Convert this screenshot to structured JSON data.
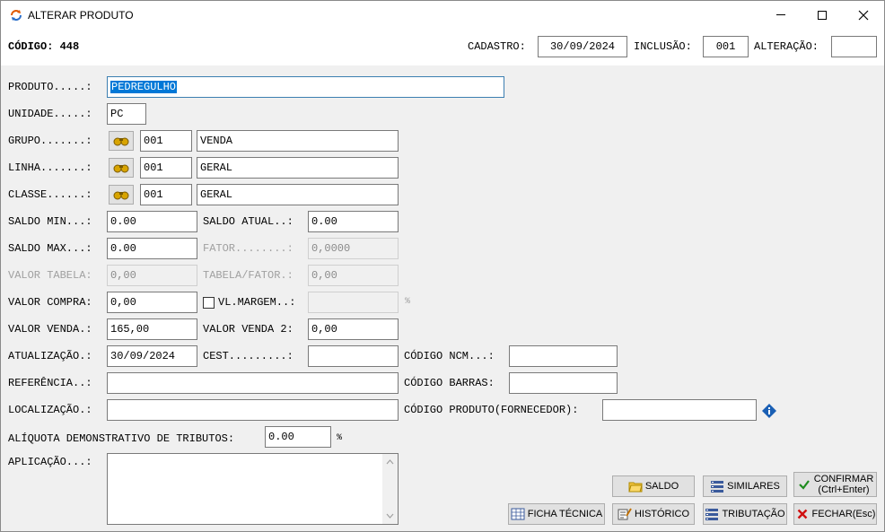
{
  "window": {
    "title": "ALTERAR PRODUTO"
  },
  "header": {
    "codigo": "CÓDIGO: 448",
    "cadastro_label": "CADASTRO:",
    "cadastro_value": "30/09/2024",
    "inclusao_label": "INCLUSÃO:",
    "inclusao_value": "001",
    "alteracao_label": "ALTERAÇÃO:",
    "alteracao_value": ""
  },
  "form": {
    "produto_label": "PRODUTO.....:",
    "produto_value": "PEDREGULHO",
    "unidade_label": "UNIDADE.....:",
    "unidade_value": "PC",
    "grupo_label": "GRUPO.......:",
    "grupo_code": "001",
    "grupo_name": "VENDA",
    "linha_label": "LINHA.......:",
    "linha_code": "001",
    "linha_name": "GERAL",
    "classe_label": "CLASSE......:",
    "classe_code": "001",
    "classe_name": "GERAL",
    "saldo_min_label": "SALDO MIN...:",
    "saldo_min_value": "0.00",
    "saldo_atual_label": "SALDO ATUAL..:",
    "saldo_atual_value": "0.00",
    "saldo_max_label": "SALDO MAX...:",
    "saldo_max_value": "0.00",
    "fator_label": "FATOR........:",
    "fator_value": "0,0000",
    "valor_tabela_label": "VALOR TABELA:",
    "valor_tabela_value": "0,00",
    "tabela_fator_label": "TABELA/FATOR.:",
    "tabela_fator_value": "0,00",
    "valor_compra_label": "VALOR COMPRA:",
    "valor_compra_value": "0,00",
    "vl_margem_label": "VL.MARGEM..:",
    "vl_margem_value": "",
    "percent": "%",
    "valor_venda_label": "VALOR VENDA.:",
    "valor_venda_value": "165,00",
    "valor_venda2_label": "VALOR VENDA 2:",
    "valor_venda2_value": "0,00",
    "atualizacao_label": "ATUALIZAÇÃO.:",
    "atualizacao_value": "30/09/2024",
    "cest_label": "CEST.........:",
    "cest_value": "",
    "ncm_label": "CÓDIGO NCM...:",
    "ncm_value": "",
    "referencia_label": "REFERÊNCIA..:",
    "referencia_value": "",
    "barras_label": "CÓDIGO BARRAS:",
    "barras_value": "",
    "localizacao_label": "LOCALIZAÇÃO.:",
    "localizacao_value": "",
    "cod_fornecedor_label": "CÓDIGO PRODUTO(FORNECEDOR):",
    "cod_fornecedor_value": "",
    "aliquota_label": "ALÍQUOTA DEMONSTRATIVO DE TRIBUTOS:",
    "aliquota_value": "0.00",
    "aliquota_percent": "%",
    "aplicacao_label": "APLICAÇÃO...:",
    "aplicacao_value": ""
  },
  "buttons": {
    "saldo": "SALDO",
    "similares": "SIMILARES",
    "confirmar_line1": "CONFIRMAR",
    "confirmar_line2": "(Ctrl+Enter)",
    "ficha_tecnica": "FICHA TÉCNICA",
    "historico": "HISTÓRICO",
    "tributacao": "TRIBUTAÇÃO",
    "fechar": "FECHAR(Esc)"
  },
  "colors": {
    "selection": "#0078d7",
    "confirm_check": "#1e8c1e",
    "close_x": "#d01010",
    "info": "#1a5fb4"
  }
}
